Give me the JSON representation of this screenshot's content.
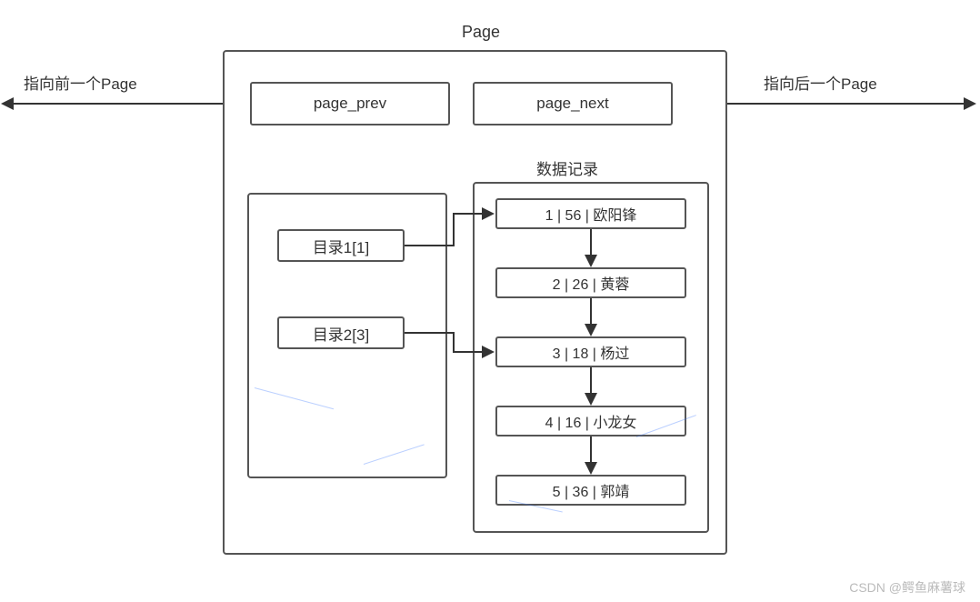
{
  "title": "Page",
  "pointers": {
    "prev_label": "指向前一个Page",
    "next_label": "指向后一个Page",
    "prev_box": "page_prev",
    "next_box": "page_next"
  },
  "records_label": "数据记录",
  "directory": {
    "entries": [
      {
        "label": "目录1[1]"
      },
      {
        "label": "目录2[3]"
      }
    ]
  },
  "records": [
    {
      "text": "1 | 56 | 欧阳锋"
    },
    {
      "text": "2 | 26 | 黄蓉"
    },
    {
      "text": "3 | 18 | 杨过"
    },
    {
      "text": "4 | 16 | 小龙女"
    },
    {
      "text": "5 | 36 | 郭靖"
    }
  ],
  "watermark": "CSDN @鳄鱼麻薯球"
}
